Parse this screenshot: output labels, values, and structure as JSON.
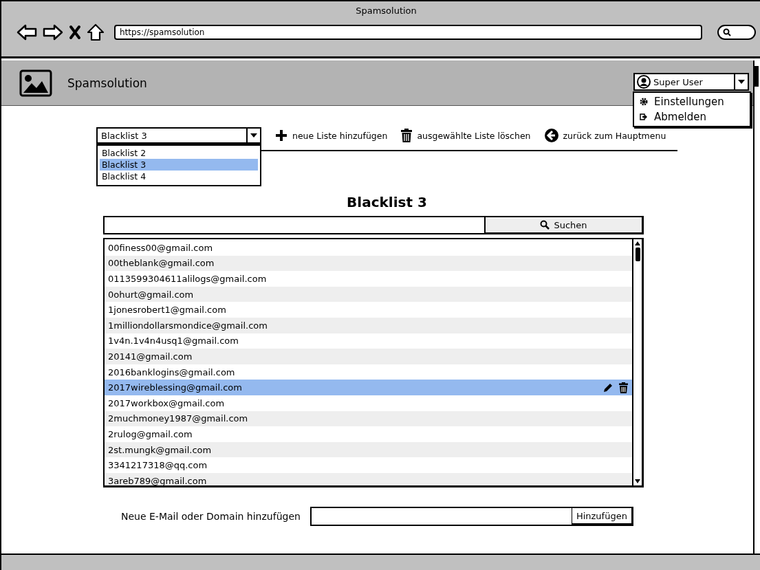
{
  "browser": {
    "title": "Spamsolution",
    "url": "https://spamsolution"
  },
  "app": {
    "title": "Spamsolution"
  },
  "user_menu": {
    "user": "Super User",
    "items": [
      {
        "label": "Einstellungen"
      },
      {
        "label": "Abmelden"
      }
    ]
  },
  "list_select": {
    "value": "Blacklist 3",
    "options": [
      {
        "label": "Blacklist 2",
        "selected": false
      },
      {
        "label": "Blacklist 3",
        "selected": true
      },
      {
        "label": "Blacklist 4",
        "selected": false
      }
    ]
  },
  "toolbar": [
    {
      "label": "neue Liste hinzufügen"
    },
    {
      "label": "ausgewählte Liste löschen"
    },
    {
      "label": "zurück zum Hauptmenu"
    }
  ],
  "heading": "Blacklist 3",
  "search": {
    "button": "Suchen"
  },
  "entries": [
    {
      "email": "00finess00@gmail.com",
      "selected": false
    },
    {
      "email": "00theblank@gmail.com",
      "selected": false
    },
    {
      "email": "0113599304611alilogs@gmail.com",
      "selected": false
    },
    {
      "email": "0ohurt@gmail.com",
      "selected": false
    },
    {
      "email": "1jonesrobert1@gmail.com",
      "selected": false
    },
    {
      "email": "1milliondollarsmondice@gmail.com",
      "selected": false
    },
    {
      "email": "1v4n.1v4n4usq1@gmail.com",
      "selected": false
    },
    {
      "email": "20141@gmail.com",
      "selected": false
    },
    {
      "email": "2016banklogins@gmail.com",
      "selected": false
    },
    {
      "email": "2017wireblessing@gmail.com",
      "selected": true
    },
    {
      "email": "2017workbox@gmail.com",
      "selected": false
    },
    {
      "email": "2muchmoney1987@gmail.com",
      "selected": false
    },
    {
      "email": "2rulog@gmail.com",
      "selected": false
    },
    {
      "email": "2st.mungk@gmail.com",
      "selected": false
    },
    {
      "email": "3341217318@qq.com",
      "selected": false
    },
    {
      "email": "3areb789@gmail.com",
      "selected": false
    }
  ],
  "add": {
    "label": "Neue E-Mail oder Domain hinzufügen",
    "button": "Hinzufügen"
  }
}
